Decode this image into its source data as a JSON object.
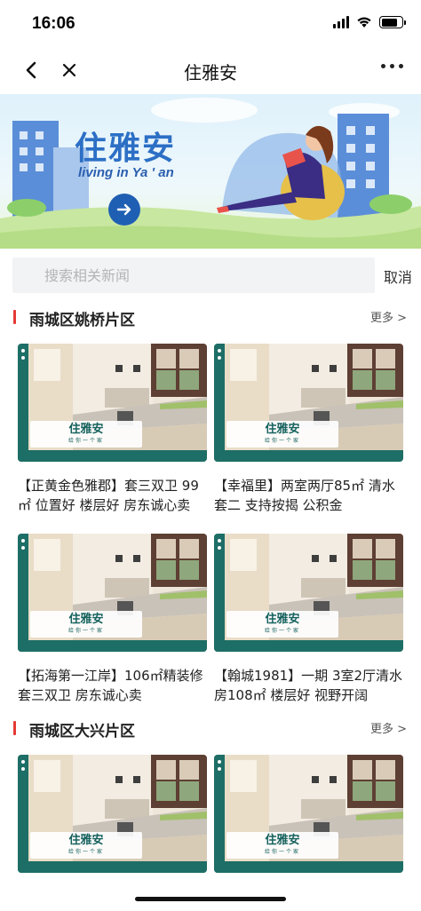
{
  "status": {
    "time": "16:06"
  },
  "nav": {
    "title": "住雅安"
  },
  "banner": {
    "title": "住雅安",
    "subtitle": "living in  Ya ' an"
  },
  "search": {
    "placeholder": "搜索相关新闻",
    "cancel_label": "取消"
  },
  "thumb": {
    "name": "住雅安",
    "slogan": "给你一个家"
  },
  "sections": [
    {
      "title": "雨城区姚桥片区",
      "more_label": "更多 >",
      "items": [
        {
          "title": "【正黄金色雅郡】套三双卫 99㎡ 位置好 楼层好 房东诚心卖"
        },
        {
          "title": "【幸福里】两室两厅85㎡ 清水套二 支持按揭 公积金"
        },
        {
          "title": "【拓海第一江岸】106㎡精装修套三双卫 房东诚心卖"
        },
        {
          "title": "【翰城1981】一期 3室2厅清水房108㎡ 楼层好 视野开阔"
        }
      ]
    },
    {
      "title": "雨城区大兴片区",
      "more_label": "更多 >",
      "items": [
        {
          "title": ""
        },
        {
          "title": ""
        }
      ]
    }
  ],
  "colors": {
    "accent_red": "#e53935",
    "brand_blue": "#2c6fc5",
    "teal": "#16625e"
  }
}
